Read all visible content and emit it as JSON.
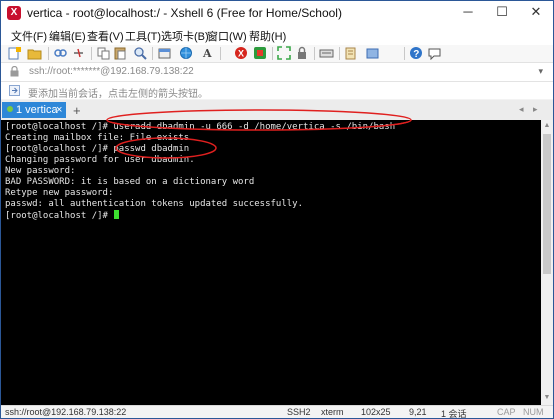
{
  "window": {
    "title": "vertica - root@localhost:/ - Xshell 6 (Free for Home/School)",
    "app_icon_letter": "X",
    "minimize_glyph": "─",
    "maximize_glyph": "☐",
    "close_glyph": "✕"
  },
  "menu": [
    "文件(F)",
    "编辑(E)",
    "查看(V)",
    "工具(T)",
    "选项卡(B)",
    "窗口(W)",
    "帮助(H)"
  ],
  "toolbar": {
    "icons": [
      "new-session-icon",
      "open-folder-icon",
      "link-icon",
      "disconnect-icon",
      "copy-icon",
      "paste-icon",
      "find-icon",
      "properties-icon",
      "globe-icon",
      "font-icon",
      "xshell-icon",
      "xftp-icon",
      "fullscreen-icon",
      "lock-icon",
      "keyboard-icon",
      "script-icon",
      "transfer-icon",
      "help-icon",
      "chat-icon"
    ]
  },
  "address": {
    "text": "ssh://root:*******@192.168.79.138:22",
    "dropdown_glyph": "▾"
  },
  "hint": {
    "text": "要添加当前会话，点击左侧的箭头按钮。"
  },
  "tabs": {
    "active_label": "1 vertica",
    "close_glyph": "×",
    "add_glyph": "+",
    "prev_glyph": "◂",
    "next_glyph": "▸"
  },
  "terminal": {
    "lines": [
      "[root@localhost /]# useradd dbadmin -u 666 -d /home/vertica -s /bin/bash",
      "Creating mailbox file: File exists",
      "[root@localhost /]# passwd dbadmin",
      "Changing password for user dbadmin.",
      "New password:",
      "BAD PASSWORD: it is based on a dictionary word",
      "Retype new password:",
      "passwd: all authentication tokens updated successfully.",
      "[root@localhost /]# "
    ],
    "cursor_color": "#3cdf2f",
    "annotation_color": "#e0201f"
  },
  "scrollbar": {
    "up_glyph": "▲",
    "down_glyph": "▼"
  },
  "status": {
    "address": "ssh://root@192.168.79.138:22",
    "protocol": "SSH2",
    "terminal_type": "xterm",
    "size": "102x25",
    "cursor_pos": "9,21",
    "sessions": "1 会话",
    "cap": "CAP",
    "num": "NUM"
  },
  "colors": {
    "tab_active": "#2e87d8",
    "window_border": "#2b5797"
  }
}
